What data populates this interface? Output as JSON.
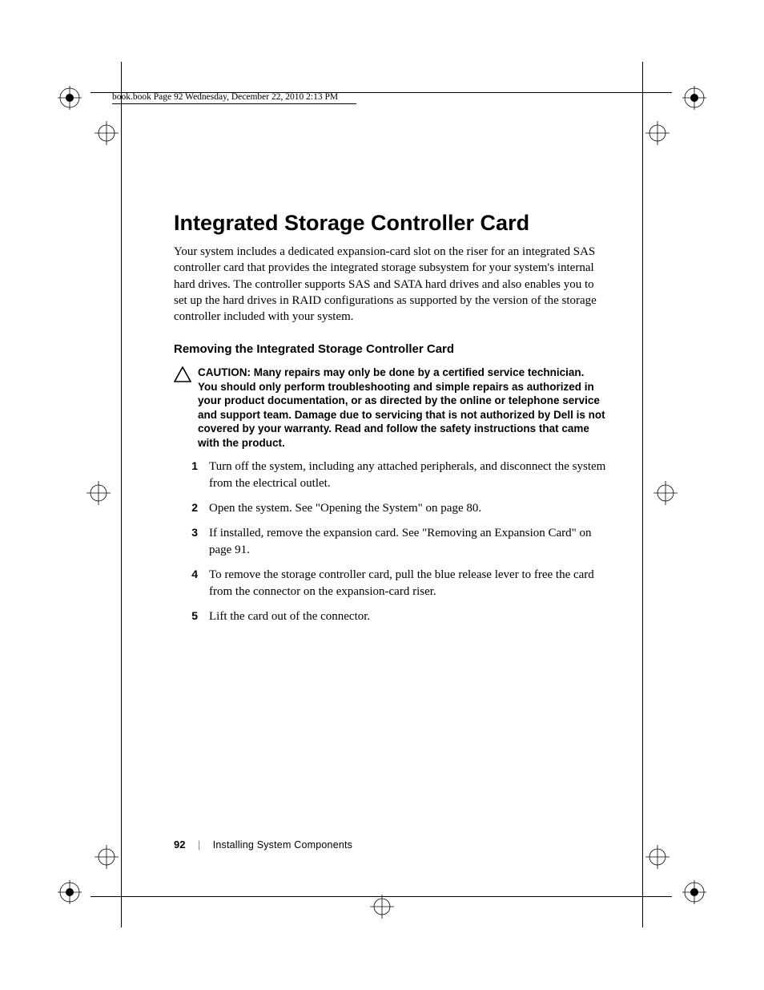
{
  "running_header": "book.book  Page 92  Wednesday, December 22, 2010  2:13 PM",
  "h1": "Integrated Storage Controller Card",
  "intro": "Your system includes a dedicated expansion-card slot on the riser for an integrated SAS controller card that provides the integrated storage subsystem for your system's internal hard drives. The controller supports SAS and SATA hard drives and also enables you to set up the hard drives in RAID configurations as supported by the version of the storage controller included with your system.",
  "h2": "Removing the Integrated Storage Controller Card",
  "caution": {
    "label": "CAUTION: ",
    "body": "Many repairs may only be done by a certified service technician. You should only perform troubleshooting and simple repairs as authorized in your product documentation, or as directed by the online or telephone service and support team. Damage due to servicing that is not authorized by Dell is not covered by your warranty. Read and follow the safety instructions that came with the product."
  },
  "steps": [
    {
      "n": "1",
      "t": "Turn off the system, including any attached peripherals, and disconnect the system from the electrical outlet."
    },
    {
      "n": "2",
      "t": "Open the system. See \"Opening the System\" on page 80."
    },
    {
      "n": "3",
      "t": "If installed, remove the expansion card. See \"Removing an Expansion Card\" on page 91."
    },
    {
      "n": "4",
      "t": "To remove the storage controller card, pull the blue release lever to free the card from the connector on the expansion-card riser."
    },
    {
      "n": "5",
      "t": "Lift the card out of the connector."
    }
  ],
  "footer": {
    "page": "92",
    "section": "Installing System Components"
  }
}
